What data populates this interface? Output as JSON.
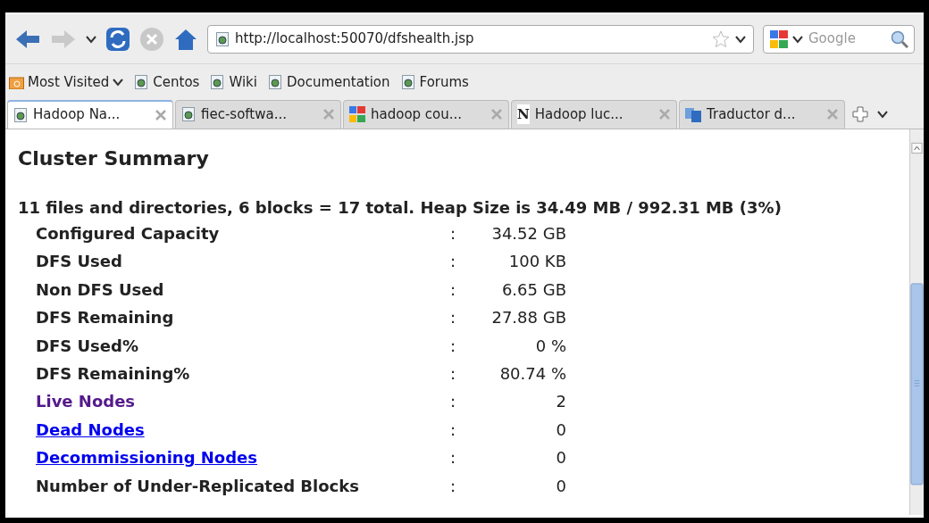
{
  "toolbar": {
    "url": "http://localhost:50070/dfshealth.jsp",
    "search_placeholder": "Google"
  },
  "bookmarks": [
    {
      "label": "Most Visited",
      "kind": "folder"
    },
    {
      "label": "Centos",
      "kind": "page"
    },
    {
      "label": "Wiki",
      "kind": "page"
    },
    {
      "label": "Documentation",
      "kind": "page"
    },
    {
      "label": "Forums",
      "kind": "page"
    }
  ],
  "tabs": [
    {
      "label": "Hadoop Na...",
      "kind": "page",
      "selected": true
    },
    {
      "label": "fiec-softwa...",
      "kind": "page",
      "selected": false
    },
    {
      "label": "hadoop cou...",
      "kind": "google",
      "selected": false
    },
    {
      "label": "Hadoop luc...",
      "kind": "letter",
      "icon_text": "N",
      "selected": false
    },
    {
      "label": "Traductor d...",
      "kind": "translate",
      "selected": false
    }
  ],
  "page": {
    "heading": "Cluster Summary",
    "summary": "11 files and directories, 6 blocks = 17 total. Heap Size is 34.49 MB / 992.31 MB (3%)",
    "rows": [
      {
        "label": "Configured Capacity",
        "kind": "text",
        "separator": ":",
        "value": "34.52 GB"
      },
      {
        "label": "DFS Used",
        "kind": "text",
        "separator": ":",
        "value": "100 KB"
      },
      {
        "label": "Non DFS Used",
        "kind": "text",
        "separator": ":",
        "value": "6.65 GB"
      },
      {
        "label": "DFS Remaining",
        "kind": "text",
        "separator": ":",
        "value": "27.88 GB"
      },
      {
        "label": "DFS Used%",
        "kind": "text",
        "separator": ":",
        "value": "0 %"
      },
      {
        "label": "DFS Remaining%",
        "kind": "text",
        "separator": ":",
        "value": "80.74 %"
      },
      {
        "label": "Live Nodes",
        "kind": "visited-link",
        "separator": ":",
        "value": "2"
      },
      {
        "label": "Dead Nodes",
        "kind": "link",
        "separator": ":",
        "value": "0"
      },
      {
        "label": "Decommissioning Nodes",
        "kind": "link",
        "separator": ":",
        "value": "0"
      },
      {
        "label": "Number of Under-Replicated Blocks",
        "kind": "text",
        "separator": ":",
        "value": "0"
      }
    ]
  }
}
